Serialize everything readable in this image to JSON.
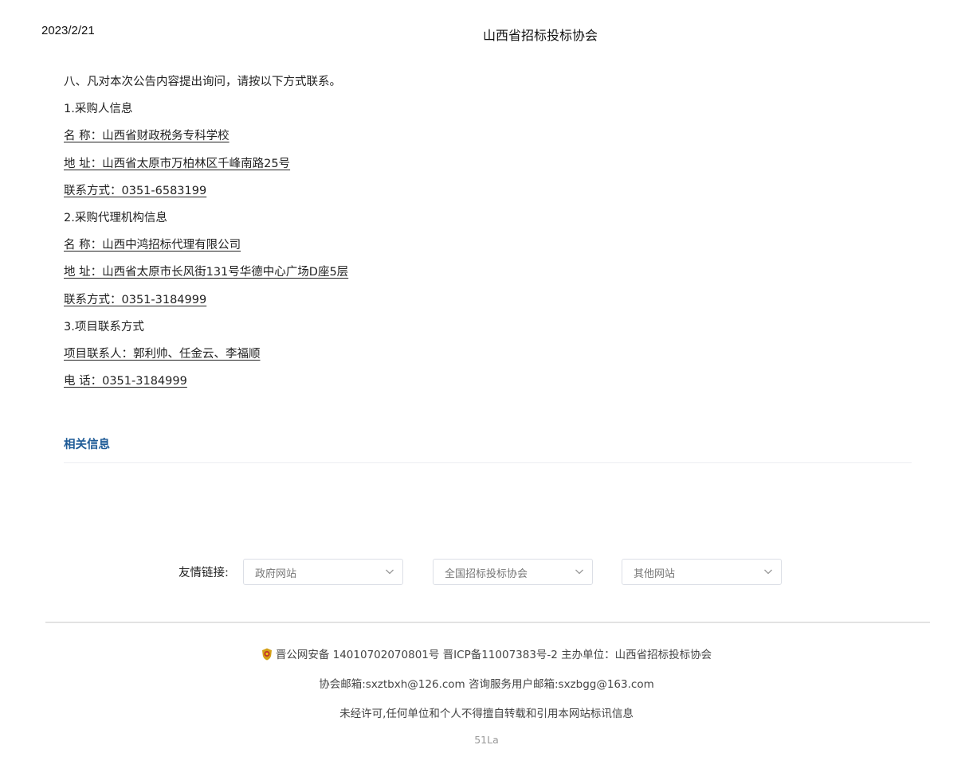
{
  "print_header": {
    "date": "2023/2/21",
    "title": "山西省招标投标协会"
  },
  "article": {
    "lines": [
      {
        "text": "八、凡对本次公告内容提出询问，请按以下方式联系。",
        "underline": false
      },
      {
        "text": "1.采购人信息",
        "underline": false
      },
      {
        "text": "名 称：山西省财政税务专科学校",
        "underline": true
      },
      {
        "text": "地 址：山西省太原市万柏林区千峰南路25号",
        "underline": true
      },
      {
        "text": "联系方式：0351-6583199",
        "underline": true
      },
      {
        "text": "2.采购代理机构信息",
        "underline": false
      },
      {
        "text": "名 称：山西中鸿招标代理有限公司",
        "underline": true
      },
      {
        "text": "地 址：山西省太原市长风街131号华德中心广场D座5层",
        "underline": true
      },
      {
        "text": "联系方式：0351-3184999",
        "underline": true
      },
      {
        "text": "3.项目联系方式",
        "underline": false
      },
      {
        "text": "项目联系人：郭利帅、任金云、李福顺",
        "underline": true
      },
      {
        "text": "电 话：0351-3184999",
        "underline": true
      }
    ]
  },
  "related": {
    "title": "相关信息"
  },
  "friend_links": {
    "label": "友情链接:",
    "selects": [
      {
        "value": "政府网站"
      },
      {
        "value": "全国招标投标协会"
      },
      {
        "value": "其他网站"
      }
    ]
  },
  "footer": {
    "icon": "police-badge-icon",
    "record_line": "晋公网安备 14010702070801号 晋ICP备11007383号-2 主办单位：山西省招标投标协会",
    "email_line": "协会邮箱:sxztbxh@126.com 咨询服务用户邮箱:sxzbgg@163.com",
    "copyright_line": "未经许可,任何单位和个人不得擅自转载和引用本网站标讯信息",
    "counter": "51La"
  },
  "colors": {
    "accent": "#1d5a96",
    "divider": "#e2e2e2"
  }
}
